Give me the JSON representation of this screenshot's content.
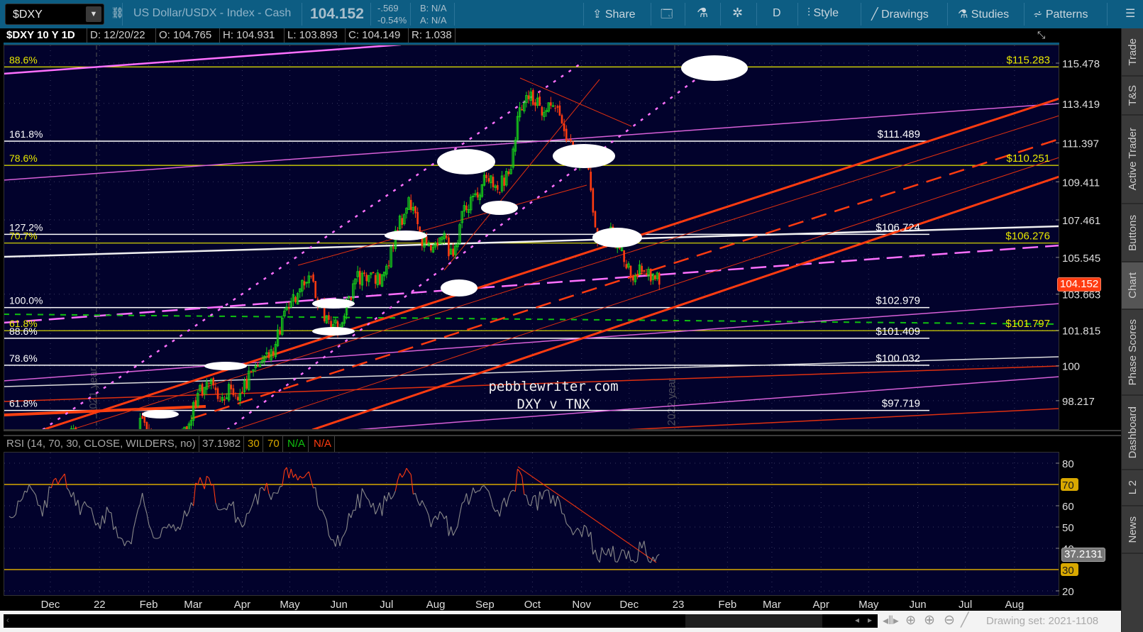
{
  "toolbar": {
    "symbol": "$DXY",
    "description": "US Dollar/USDX - Index - Cash",
    "last": "104.152",
    "change": "-.569",
    "change_pct": "-0.54%",
    "bid": "B: N/A",
    "ask": "A: N/A",
    "share": "Share",
    "period": "D",
    "style": "Style",
    "drawings": "Drawings",
    "studies": "Studies",
    "patterns": "Patterns"
  },
  "info": {
    "title": "$DXY 10 Y 1D",
    "date": "D: 12/20/22",
    "open": "O: 104.765",
    "high": "H: 104.931",
    "low": "L: 103.893",
    "close": "C: 104.149",
    "range": "R: 1.038"
  },
  "sidebar": {
    "tabs": [
      "Trade",
      "T&S",
      "Active Trader",
      "Buttons",
      "Chart",
      "Phase Scores",
      "Dashboard",
      "L 2",
      "News"
    ],
    "active": "Chart"
  },
  "watermark": {
    "line1": "pebblewriter.com",
    "line2": "DXY v TNX"
  },
  "year_markers": [
    "2021 year",
    "2022 year"
  ],
  "chart_data": {
    "type": "candlestick",
    "symbol": "$DXY",
    "price_ticks": [
      115.478,
      113.419,
      111.397,
      109.411,
      107.461,
      105.545,
      103.663,
      101.815,
      100,
      98.217
    ],
    "price_tick_labels": [
      "115.478",
      "113.419",
      "111.397",
      "109.411",
      "107.461",
      "105.545",
      "103.663",
      "101.815",
      "100",
      "98.217"
    ],
    "current_price": 104.152,
    "current_price_label": "104.152",
    "fib_levels": [
      {
        "label": "88.6%",
        "price": 115.283,
        "tag": "$115.283",
        "color": "#e8e800",
        "full": true
      },
      {
        "label": "161.8%",
        "price": 111.489,
        "tag": "$111.489",
        "color": "#ffffff",
        "full": false
      },
      {
        "label": "78.6%",
        "price": 110.251,
        "tag": "$110.251",
        "color": "#e8e800",
        "full": true
      },
      {
        "label": "127.2%",
        "price": 106.724,
        "tag": "$106.724",
        "color": "#ffffff",
        "full": false
      },
      {
        "label": "70.7%",
        "price": 106.276,
        "tag": "$106.276",
        "color": "#e8e800",
        "full": true
      },
      {
        "label": "100.0%",
        "price": 102.979,
        "tag": "$102.979",
        "color": "#ffffff",
        "full": false
      },
      {
        "label": "61.8%",
        "price": 101.797,
        "tag": "$101.797",
        "color": "#e8e800",
        "full": true
      },
      {
        "label": "88.6%",
        "price": 101.409,
        "tag": "$101.409",
        "color": "#ffffff",
        "full": false
      },
      {
        "label": "78.6%",
        "price": 100.032,
        "tag": "$100.032",
        "color": "#ffffff",
        "full": false
      },
      {
        "label": "61.8%",
        "price": 97.719,
        "tag": "$97.719",
        "color": "#ffffff",
        "full": false
      }
    ],
    "x_labels": [
      "Dec",
      "22",
      "Feb",
      "Mar",
      "Apr",
      "May",
      "Jun",
      "Jul",
      "Aug",
      "Sep",
      "Oct",
      "Nov",
      "Dec",
      "23",
      "Feb",
      "Mar",
      "Apr",
      "May",
      "Jun",
      "Jul",
      "Aug"
    ],
    "x_label_days": [
      0,
      31,
      62,
      90,
      121,
      151,
      182,
      212,
      243,
      274,
      304,
      335,
      365,
      396,
      427,
      455,
      486,
      516,
      547,
      577,
      608
    ],
    "weekly_start_day": -26,
    "weekly_closes": [
      94.3,
      95.1,
      96.0,
      96.1,
      96.1,
      96.1,
      96.6,
      96.0,
      95.7,
      95.7,
      95.2,
      95.6,
      97.3,
      95.5,
      96.0,
      96.0,
      96.6,
      98.6,
      99.1,
      98.2,
      98.8,
      98.6,
      99.8,
      100.5,
      101.1,
      103.0,
      103.7,
      104.6,
      103.2,
      101.7,
      102.2,
      104.2,
      104.7,
      104.2,
      105.1,
      106.9,
      108.6,
      106.7,
      105.9,
      106.6,
      105.6,
      108.2,
      108.8,
      109.6,
      109.0,
      109.8,
      113.2,
      114.0,
      112.8,
      113.3,
      112.0,
      110.8,
      110.8,
      106.3,
      106.9,
      106.0,
      104.5,
      104.8,
      104.7,
      104.15
    ],
    "rsi": {
      "header": "RSI (14, 70, 30, CLOSE, WILDERS, no)",
      "value": "37.1982",
      "over_sold": "30",
      "over_bought": "70",
      "up": "N/A",
      "down": "N/A",
      "ticks": [
        80,
        60,
        50,
        40,
        20
      ],
      "levels": [
        70,
        30
      ],
      "current_label": "37.2131",
      "weekly_values": [
        55,
        62,
        68,
        55,
        72,
        75,
        60,
        60,
        52,
        57,
        45,
        42,
        66,
        45,
        50,
        48,
        55,
        70,
        73,
        58,
        60,
        50,
        62,
        67,
        66,
        78,
        72,
        76,
        58,
        44,
        45,
        58,
        66,
        56,
        62,
        72,
        76,
        60,
        50,
        56,
        46,
        62,
        66,
        68,
        58,
        64,
        76,
        60,
        63,
        65,
        56,
        48,
        50,
        35,
        40,
        36,
        34,
        40,
        36,
        37.2
      ]
    }
  },
  "footer": {
    "drawing_set": "Drawing set: 2021-1108"
  }
}
